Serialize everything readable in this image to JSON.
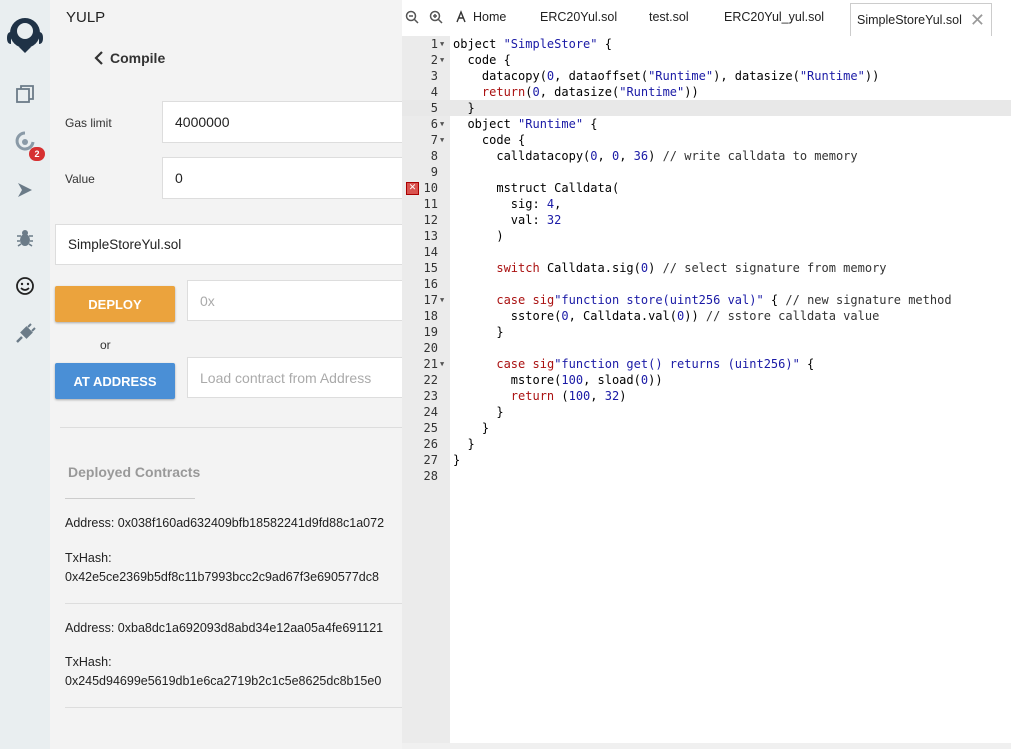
{
  "panel": {
    "title": "YULP",
    "back_label": "Compile"
  },
  "rail": {
    "badge_count": "2"
  },
  "run": {
    "gas_limit_label": "Gas limit",
    "gas_limit_value": "4000000",
    "value_label": "Value",
    "value_value": "0",
    "contract_select": "SimpleStoreYul.sol",
    "deploy_label": "DEPLOY",
    "deploy_placeholder": "0x",
    "or_label": "or",
    "at_address_label": "AT ADDRESS",
    "at_address_placeholder": "Load contract from Address"
  },
  "deployed": {
    "title": "Deployed Contracts",
    "items": [
      {
        "address": "Address: 0x038f160ad632409bfb18582241d9fd88c1a072",
        "txhash_label": "TxHash:",
        "txhash": "0x42e5ce2369b5df8c11b7993bcc2c9ad67f3e690577dc8"
      },
      {
        "address": "Address: 0xba8dc1a692093d8abd34e12aa05a4fe691121",
        "txhash_label": "TxHash:",
        "txhash": "0x245d94699e5619db1e6ca2719b2c1c5e8625dc8b15e0"
      }
    ]
  },
  "tabs": [
    {
      "label": "Home"
    },
    {
      "label": "ERC20Yul.sol"
    },
    {
      "label": "test.sol"
    },
    {
      "label": "ERC20Yul_yul.sol"
    },
    {
      "label": "SimpleStoreYul.sol"
    }
  ],
  "editor": {
    "lines": [
      "object \"SimpleStore\" {",
      "  code {",
      "    datacopy(0, dataoffset(\"Runtime\"), datasize(\"Runtime\"))",
      "    return(0, datasize(\"Runtime\"))",
      "  }",
      "  object \"Runtime\" {",
      "    code {",
      "      calldatacopy(0, 0, 36) // write calldata to memory",
      "",
      "      mstruct Calldata(",
      "        sig: 4,",
      "        val: 32",
      "      )",
      "",
      "      switch Calldata.sig(0) // select signature from memory",
      "",
      "      case sig\"function store(uint256 val)\" { // new signature method",
      "        sstore(0, Calldata.val(0)) // sstore calldata value",
      "      }",
      "",
      "      case sig\"function get() returns (uint256)\" {",
      "        mstore(100, sload(0))",
      "        return (100, 32)",
      "      }",
      "    }",
      "  }",
      "}",
      ""
    ],
    "fold_lines": [
      1,
      2,
      6,
      7,
      17,
      21
    ],
    "error_lines": [
      10
    ],
    "highlight_line": 5
  }
}
